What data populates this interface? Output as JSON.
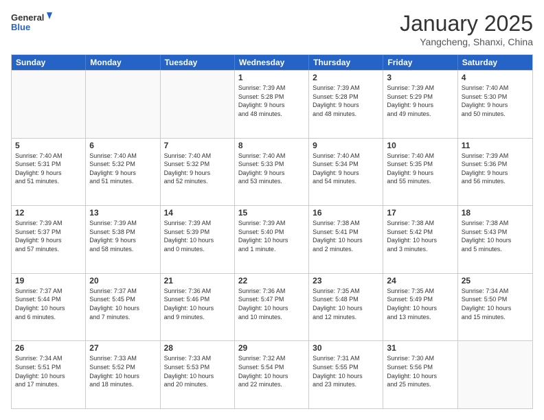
{
  "logo": {
    "line1": "General",
    "line2": "Blue"
  },
  "title": "January 2025",
  "location": "Yangcheng, Shanxi, China",
  "weekdays": [
    "Sunday",
    "Monday",
    "Tuesday",
    "Wednesday",
    "Thursday",
    "Friday",
    "Saturday"
  ],
  "rows": [
    [
      {
        "day": "",
        "info": ""
      },
      {
        "day": "",
        "info": ""
      },
      {
        "day": "",
        "info": ""
      },
      {
        "day": "1",
        "info": "Sunrise: 7:39 AM\nSunset: 5:28 PM\nDaylight: 9 hours\nand 48 minutes."
      },
      {
        "day": "2",
        "info": "Sunrise: 7:39 AM\nSunset: 5:28 PM\nDaylight: 9 hours\nand 48 minutes."
      },
      {
        "day": "3",
        "info": "Sunrise: 7:39 AM\nSunset: 5:29 PM\nDaylight: 9 hours\nand 49 minutes."
      },
      {
        "day": "4",
        "info": "Sunrise: 7:40 AM\nSunset: 5:30 PM\nDaylight: 9 hours\nand 50 minutes."
      }
    ],
    [
      {
        "day": "5",
        "info": "Sunrise: 7:40 AM\nSunset: 5:31 PM\nDaylight: 9 hours\nand 51 minutes."
      },
      {
        "day": "6",
        "info": "Sunrise: 7:40 AM\nSunset: 5:32 PM\nDaylight: 9 hours\nand 51 minutes."
      },
      {
        "day": "7",
        "info": "Sunrise: 7:40 AM\nSunset: 5:32 PM\nDaylight: 9 hours\nand 52 minutes."
      },
      {
        "day": "8",
        "info": "Sunrise: 7:40 AM\nSunset: 5:33 PM\nDaylight: 9 hours\nand 53 minutes."
      },
      {
        "day": "9",
        "info": "Sunrise: 7:40 AM\nSunset: 5:34 PM\nDaylight: 9 hours\nand 54 minutes."
      },
      {
        "day": "10",
        "info": "Sunrise: 7:40 AM\nSunset: 5:35 PM\nDaylight: 9 hours\nand 55 minutes."
      },
      {
        "day": "11",
        "info": "Sunrise: 7:39 AM\nSunset: 5:36 PM\nDaylight: 9 hours\nand 56 minutes."
      }
    ],
    [
      {
        "day": "12",
        "info": "Sunrise: 7:39 AM\nSunset: 5:37 PM\nDaylight: 9 hours\nand 57 minutes."
      },
      {
        "day": "13",
        "info": "Sunrise: 7:39 AM\nSunset: 5:38 PM\nDaylight: 9 hours\nand 58 minutes."
      },
      {
        "day": "14",
        "info": "Sunrise: 7:39 AM\nSunset: 5:39 PM\nDaylight: 10 hours\nand 0 minutes."
      },
      {
        "day": "15",
        "info": "Sunrise: 7:39 AM\nSunset: 5:40 PM\nDaylight: 10 hours\nand 1 minute."
      },
      {
        "day": "16",
        "info": "Sunrise: 7:38 AM\nSunset: 5:41 PM\nDaylight: 10 hours\nand 2 minutes."
      },
      {
        "day": "17",
        "info": "Sunrise: 7:38 AM\nSunset: 5:42 PM\nDaylight: 10 hours\nand 3 minutes."
      },
      {
        "day": "18",
        "info": "Sunrise: 7:38 AM\nSunset: 5:43 PM\nDaylight: 10 hours\nand 5 minutes."
      }
    ],
    [
      {
        "day": "19",
        "info": "Sunrise: 7:37 AM\nSunset: 5:44 PM\nDaylight: 10 hours\nand 6 minutes."
      },
      {
        "day": "20",
        "info": "Sunrise: 7:37 AM\nSunset: 5:45 PM\nDaylight: 10 hours\nand 7 minutes."
      },
      {
        "day": "21",
        "info": "Sunrise: 7:36 AM\nSunset: 5:46 PM\nDaylight: 10 hours\nand 9 minutes."
      },
      {
        "day": "22",
        "info": "Sunrise: 7:36 AM\nSunset: 5:47 PM\nDaylight: 10 hours\nand 10 minutes."
      },
      {
        "day": "23",
        "info": "Sunrise: 7:35 AM\nSunset: 5:48 PM\nDaylight: 10 hours\nand 12 minutes."
      },
      {
        "day": "24",
        "info": "Sunrise: 7:35 AM\nSunset: 5:49 PM\nDaylight: 10 hours\nand 13 minutes."
      },
      {
        "day": "25",
        "info": "Sunrise: 7:34 AM\nSunset: 5:50 PM\nDaylight: 10 hours\nand 15 minutes."
      }
    ],
    [
      {
        "day": "26",
        "info": "Sunrise: 7:34 AM\nSunset: 5:51 PM\nDaylight: 10 hours\nand 17 minutes."
      },
      {
        "day": "27",
        "info": "Sunrise: 7:33 AM\nSunset: 5:52 PM\nDaylight: 10 hours\nand 18 minutes."
      },
      {
        "day": "28",
        "info": "Sunrise: 7:33 AM\nSunset: 5:53 PM\nDaylight: 10 hours\nand 20 minutes."
      },
      {
        "day": "29",
        "info": "Sunrise: 7:32 AM\nSunset: 5:54 PM\nDaylight: 10 hours\nand 22 minutes."
      },
      {
        "day": "30",
        "info": "Sunrise: 7:31 AM\nSunset: 5:55 PM\nDaylight: 10 hours\nand 23 minutes."
      },
      {
        "day": "31",
        "info": "Sunrise: 7:30 AM\nSunset: 5:56 PM\nDaylight: 10 hours\nand 25 minutes."
      },
      {
        "day": "",
        "info": ""
      }
    ]
  ]
}
